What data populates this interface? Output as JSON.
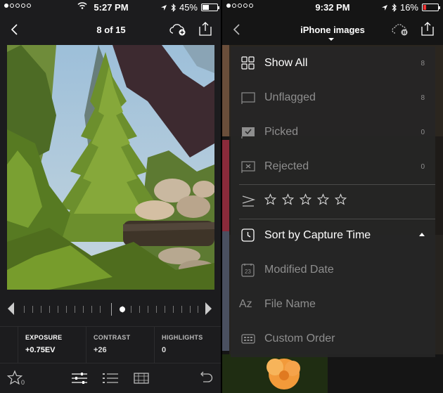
{
  "left": {
    "status": {
      "time": "5:27 PM",
      "battery": "45%"
    },
    "nav": {
      "title": "8 of 15"
    },
    "params": [
      {
        "label": "EXPOSURE",
        "value": "+0.75EV",
        "active": true
      },
      {
        "label": "CONTRAST",
        "value": "+26",
        "active": false
      },
      {
        "label": "HIGHLIGHTS",
        "value": "0",
        "active": false
      }
    ],
    "toolbar": {
      "star_count": "0"
    }
  },
  "right": {
    "status": {
      "time": "9:32 PM",
      "battery": "16%"
    },
    "nav": {
      "title": "iPhone images"
    },
    "menu": {
      "show_all": {
        "label": "Show All",
        "count": "8"
      },
      "unflagged": {
        "label": "Unflagged",
        "count": "8"
      },
      "picked": {
        "label": "Picked",
        "count": "0"
      },
      "rejected": {
        "label": "Rejected",
        "count": "0"
      },
      "sort_capture": {
        "label": "Sort by Capture Time"
      },
      "modified": {
        "label": "Modified Date",
        "icon_text": "23"
      },
      "file_name": {
        "label": "File Name",
        "icon_text": "Az"
      },
      "custom": {
        "label": "Custom Order"
      }
    }
  },
  "colors": {
    "accent": "#ffffff",
    "background": "#1c1c1e",
    "battery_low": "#ee3333",
    "dim_text": "#8e8e8e"
  }
}
